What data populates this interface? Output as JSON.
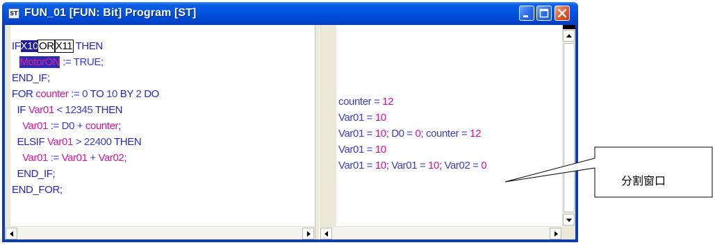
{
  "window": {
    "title": "FUN_01 [FUN: Bit] Program [ST]",
    "icon_label": "ST",
    "controls": [
      "minimize",
      "maximize",
      "close"
    ]
  },
  "code": {
    "line1": {
      "kw1": "IF",
      "v1": "X10",
      "op": "OR",
      "v2": "X11",
      "kw2": "THEN"
    },
    "line2": {
      "var": "MotorON",
      "rest": ":= TRUE;"
    },
    "line3": "END_IF;",
    "line4": {
      "kw1": "FOR ",
      "var": "counter",
      "rest1": " := 0 ",
      "kw2": "TO",
      "rest2": " 10 ",
      "kw3": "BY",
      "rest3": " 2 ",
      "kw4": "DO"
    },
    "line5": {
      "kw1": "  IF ",
      "var": "Var01",
      "rest": " < 12345 ",
      "kw2": "THEN"
    },
    "line6": {
      "var1": "    Var01",
      "rest1": " := D0 + ",
      "var2": "counter",
      "rest2": ";"
    },
    "line7": {
      "kw1": "  ELSIF ",
      "var": "Var01",
      "rest": " > 22400 ",
      "kw2": "THEN"
    },
    "line8": {
      "var1": "    Var01",
      "rest1": " := ",
      "var2": "Var01",
      "rest2": " + ",
      "var3": "Var02",
      "rest3": ";"
    },
    "line9": "  END_IF;",
    "line10": "END_FOR;"
  },
  "monitor": {
    "row1": {
      "a": "counter = ",
      "b": "12"
    },
    "row2": {
      "a": "Var01 = ",
      "b": "10"
    },
    "row3": {
      "a": "Var01 = ",
      "b": "10",
      "c": "; D0 = ",
      "d": "0",
      "e": "; counter = ",
      "f": "12"
    },
    "row4": {
      "a": "Var01 = ",
      "b": "10"
    },
    "row5": {
      "a": "Var01 = ",
      "b": "10",
      "c": "; Var01 = ",
      "d": "10",
      "e": "; Var02 = ",
      "f": "0"
    }
  },
  "callout": {
    "label": "分割窗口"
  },
  "colors": {
    "keyword": "#2323c8",
    "variable": "#d4149e",
    "selection": "#1c1c9c",
    "titlebar": "#0054e3"
  }
}
